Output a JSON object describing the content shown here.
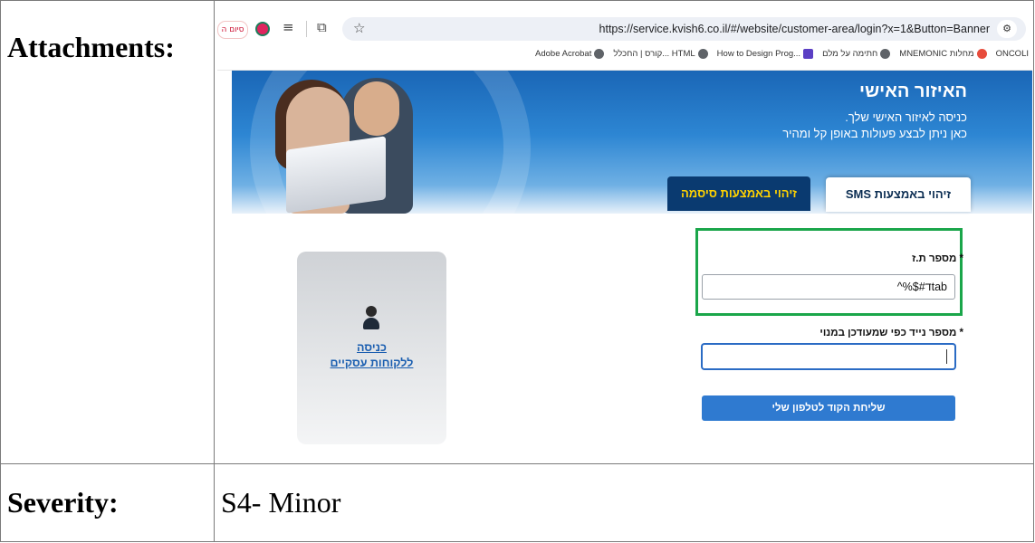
{
  "document": {
    "attachments_label": "Attachments:",
    "severity_label": "Severity:",
    "severity_value": "S4- Minor"
  },
  "browser": {
    "tab_text": "סיום ה",
    "url": "https://service.kvish6.co.il/#/website/customer-area/login?x=1&Button=Banner",
    "bookmarks": [
      {
        "label": "ONCOLI",
        "icon": "globe-icon"
      },
      {
        "label": "MNEMONIC מחלות",
        "icon": "red-icon"
      },
      {
        "label": "חתימה על מלם",
        "icon": "globe-icon"
      },
      {
        "label": "How to Design Prog...",
        "icon": "purple-icon"
      },
      {
        "label": "קורס | החכלל... HTML",
        "icon": "globe-icon"
      },
      {
        "label": "Adobe Acrobat",
        "icon": "globe-icon"
      }
    ]
  },
  "hero": {
    "title": "האיזור האישי",
    "line1": "כניסה לאיזור האישי שלך.",
    "line2": "כאן ניתן לבצע פעולות באופן קל ומהיר"
  },
  "tabs": {
    "sms": "זיהוי באמצעות SMS",
    "password": "זיהוי באמצעות סיסמה"
  },
  "form": {
    "id_label": "* מספר ת.ז",
    "id_value": "tabד#$%^",
    "phone_label": "* מספר נייד כפי שמעודכן במנוי",
    "phone_value": "",
    "submit": "שליחת הקוד לטלפון שלי"
  },
  "business": {
    "link_line1": "כניסה",
    "link_line2": "ללקוחות עסקיים"
  },
  "colors": {
    "highlight": "#1aa64a",
    "primary": "#2f7ad0",
    "dark_tab": "#0a3a70",
    "tab_text_gold": "#ffd200"
  }
}
